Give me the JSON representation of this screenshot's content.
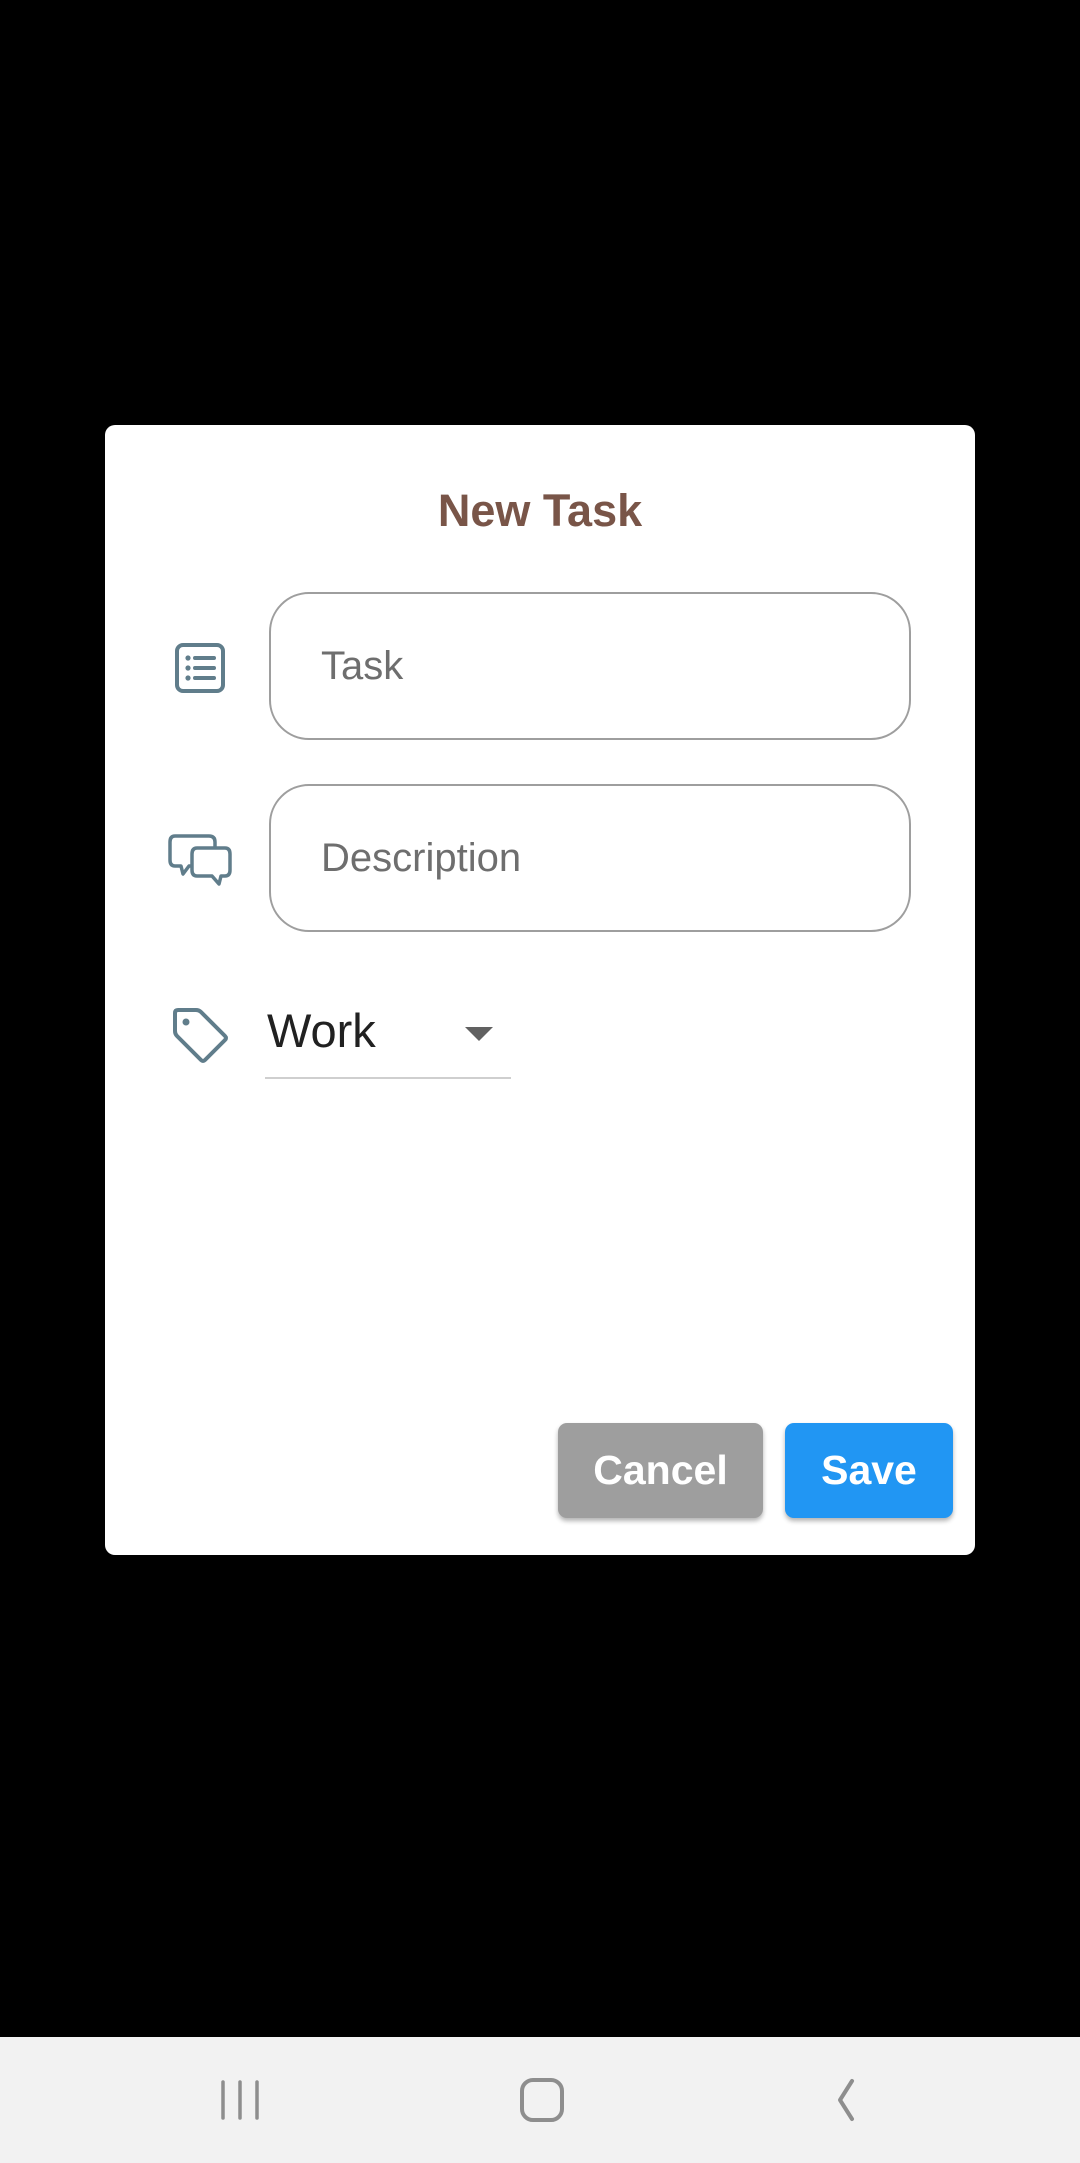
{
  "dialog": {
    "title": "New Task",
    "task_field": {
      "placeholder": "Task",
      "value": "",
      "icon": "list-icon"
    },
    "description_field": {
      "placeholder": "Description",
      "value": "",
      "icon": "chat-bubbles-icon"
    },
    "category_dropdown": {
      "selected": "Work",
      "icon": "tag-icon"
    },
    "cancel_label": "Cancel",
    "save_label": "Save"
  },
  "colors": {
    "title": "#795548",
    "icon": "#607d8b",
    "cancel_bg": "#9e9e9e",
    "save_bg": "#2196f3"
  },
  "navbar": {
    "items": [
      {
        "icon": "recent-apps-icon"
      },
      {
        "icon": "home-icon"
      },
      {
        "icon": "back-icon"
      }
    ]
  }
}
